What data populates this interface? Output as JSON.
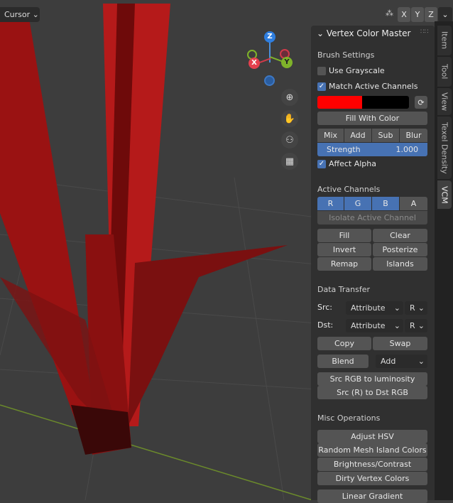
{
  "header": {
    "cursor_label": "Cursor",
    "axes": [
      "X",
      "Y",
      "Z"
    ]
  },
  "gizmo": {
    "z": "Z",
    "x": "X",
    "y": "Y"
  },
  "nav_icons": [
    "zoom-icon",
    "hand-pan-icon",
    "camera-icon",
    "grid-perspective-icon"
  ],
  "tabs": [
    "Item",
    "Tool",
    "View",
    "Texel Density",
    "VCM"
  ],
  "panel": {
    "title": "Vertex Color Master",
    "brush_settings": "Brush Settings",
    "use_grayscale": {
      "label": "Use Grayscale",
      "checked": false
    },
    "match_active": {
      "label": "Match Active Channels",
      "checked": true
    },
    "colors": {
      "primary": "#ff0000",
      "secondary": "#000000"
    },
    "fill_with_color": "Fill With Color",
    "blend_modes": [
      "Mix",
      "Add",
      "Sub",
      "Blur"
    ],
    "strength": {
      "label": "Strength",
      "value": "1.000"
    },
    "affect_alpha": {
      "label": "Affect Alpha",
      "checked": true
    },
    "active_channels": "Active Channels",
    "channels": [
      {
        "label": "R",
        "on": true
      },
      {
        "label": "G",
        "on": true
      },
      {
        "label": "B",
        "on": true
      },
      {
        "label": "A",
        "on": false
      }
    ],
    "isolate": "Isolate Active Channel",
    "ops": [
      "Fill",
      "Clear",
      "Invert",
      "Posterize",
      "Remap",
      "Islands"
    ],
    "data_transfer": "Data Transfer",
    "src": {
      "label": "Src:",
      "value": "Attribute",
      "channel": "R"
    },
    "dst": {
      "label": "Dst:",
      "value": "Attribute",
      "channel": "R"
    },
    "copy": "Copy",
    "swap": "Swap",
    "blend": "Blend",
    "blend_mode": "Add",
    "src_rgb_lum": "Src RGB to luminosity",
    "src_r_dst": "Src (R) to Dst RGB",
    "misc": "Misc Operations",
    "misc_ops": [
      "Adjust HSV",
      "Random Mesh Island Colors",
      "Brightness/Contrast",
      "Dirty Vertex Colors",
      "Linear Gradient"
    ]
  }
}
